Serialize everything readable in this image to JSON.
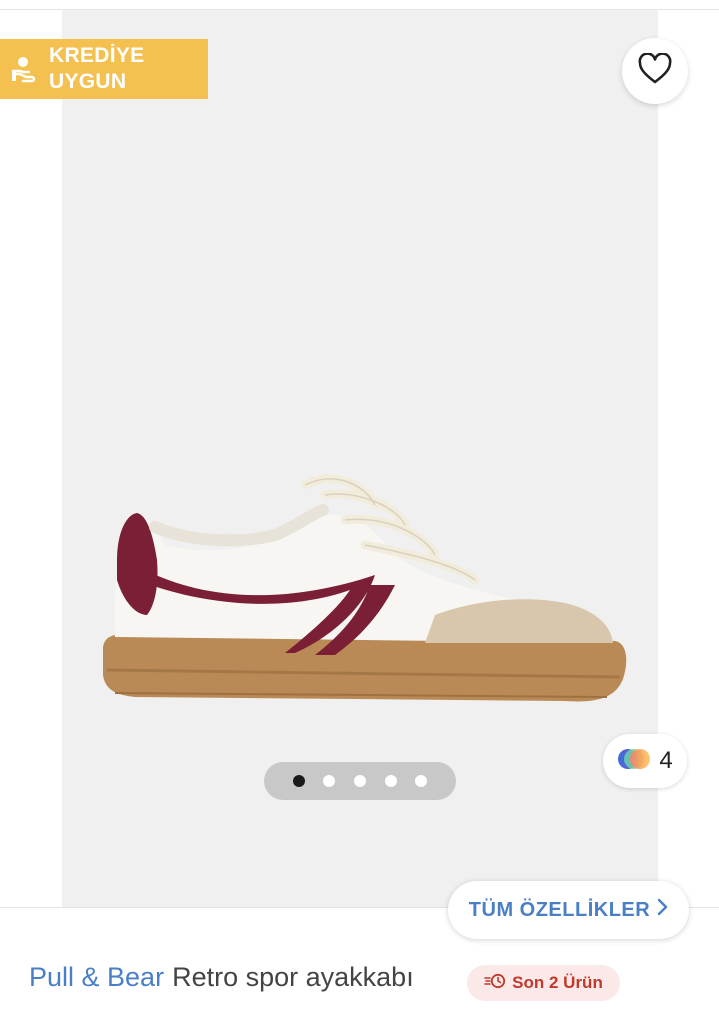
{
  "badge": {
    "line1": "KREDİYE",
    "line2": "UYGUN",
    "icon": "hand-coin-icon",
    "color": "#f4c150"
  },
  "favorite": {
    "icon": "heart-icon"
  },
  "gallery": {
    "image": "sneaker-product-image",
    "current_index": 1,
    "total": 5
  },
  "colors": {
    "icon": "color-swatch-icon",
    "count": "4"
  },
  "features_button": {
    "label": "TÜM ÖZELLİKLER",
    "icon": "chevron-right-icon"
  },
  "product": {
    "brand": "Pull & Bear",
    "name": "Retro spor ayakkabı"
  },
  "stock": {
    "label": "Son 2 Ürün",
    "icon": "fast-clock-icon",
    "color": "#c0392b"
  },
  "accent_color": "#4a7fc6"
}
